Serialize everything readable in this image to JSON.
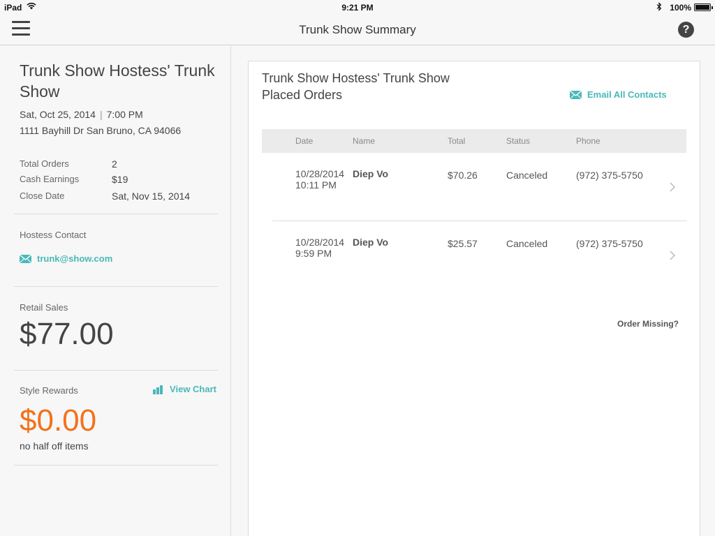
{
  "status_bar": {
    "device": "iPad",
    "time": "9:21 PM",
    "battery": "100%",
    "icons": [
      "wifi-icon",
      "bluetooth-icon",
      "battery-icon"
    ]
  },
  "nav": {
    "title": "Trunk Show Summary",
    "menu_icon": "hamburger-menu-icon",
    "help_label": "?"
  },
  "show": {
    "title": "Trunk Show Hostess' Trunk Show",
    "date": "Sat, Oct 25, 2014",
    "separator": "|",
    "time": "7:00 PM",
    "address": "1111 Bayhill Dr San Bruno, CA 94066",
    "stats": [
      {
        "label": "Total Orders",
        "value": "2"
      },
      {
        "label": "Cash Earnings",
        "value": "$19"
      },
      {
        "label": "Close Date",
        "value": "Sat, Nov 15, 2014"
      }
    ],
    "hostess_contact_label": "Hostess Contact",
    "hostess_email": "trunk@show.com",
    "retail_sales_label": "Retail Sales",
    "retail_sales_value": "$77.00",
    "style_rewards_label": "Style Rewards",
    "view_chart_label": "View Chart",
    "style_rewards_value": "$0.00",
    "style_rewards_note": "no half off items"
  },
  "orders": {
    "title_line1": "Trunk Show Hostess' Trunk Show",
    "title_line2": "Placed Orders",
    "email_all_label": "Email All Contacts",
    "columns": [
      "Date",
      "Name",
      "Total",
      "Status",
      "Phone"
    ],
    "rows": [
      {
        "date": "10/28/2014",
        "time": "10:11 PM",
        "name": "Diep Vo",
        "total": "$70.26",
        "status": "Canceled",
        "phone": "(972) 375-5750"
      },
      {
        "date": "10/28/2014",
        "time": "9:59 PM",
        "name": "Diep Vo",
        "total": "$25.57",
        "status": "Canceled",
        "phone": "(972) 375-5750"
      }
    ],
    "order_missing_label": "Order Missing?"
  },
  "colors": {
    "accent": "#4ab8b8",
    "rewards": "#f2721c",
    "text": "#444444"
  }
}
